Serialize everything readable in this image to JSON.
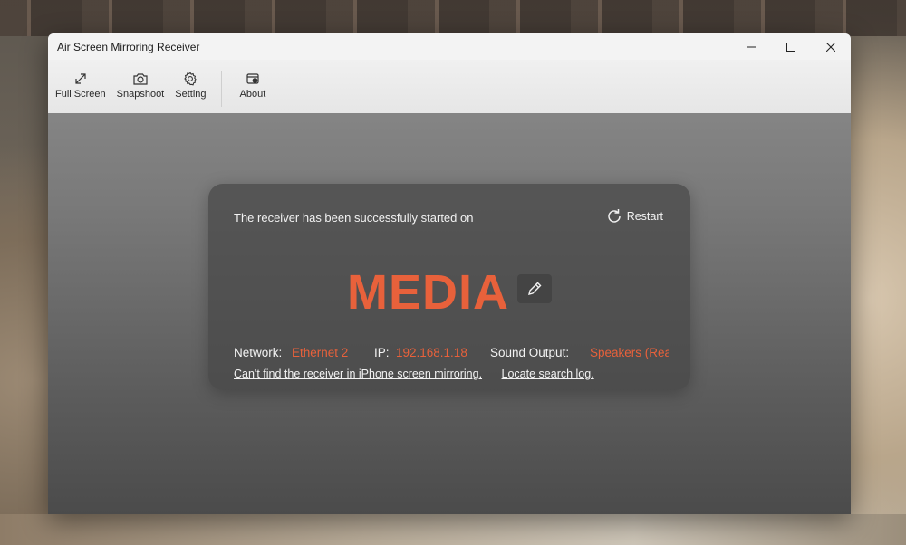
{
  "window": {
    "title": "Air Screen Mirroring Receiver"
  },
  "toolbar": {
    "items": [
      {
        "label": "Full Screen",
        "icon": "expand-icon"
      },
      {
        "label": "Snapshoot",
        "icon": "camera-icon"
      },
      {
        "label": "Setting",
        "icon": "gear-icon"
      },
      {
        "label": "About",
        "icon": "info-icon"
      }
    ]
  },
  "card": {
    "status": "The receiver has been successfully started on",
    "restart_label": "Restart",
    "device_name": "MEDIA",
    "network_label": "Network:",
    "network_value": "Ethernet 2",
    "ip_label": "IP:",
    "ip_value": "192.168.1.18",
    "sound_label": "Sound Output:",
    "sound_value": "Speakers (Rea",
    "help_link": "Can't find the receiver in iPhone screen mirroring.",
    "log_link": "Locate search log."
  },
  "colors": {
    "accent": "#e8613b",
    "text_light": "#f2f2f2"
  }
}
